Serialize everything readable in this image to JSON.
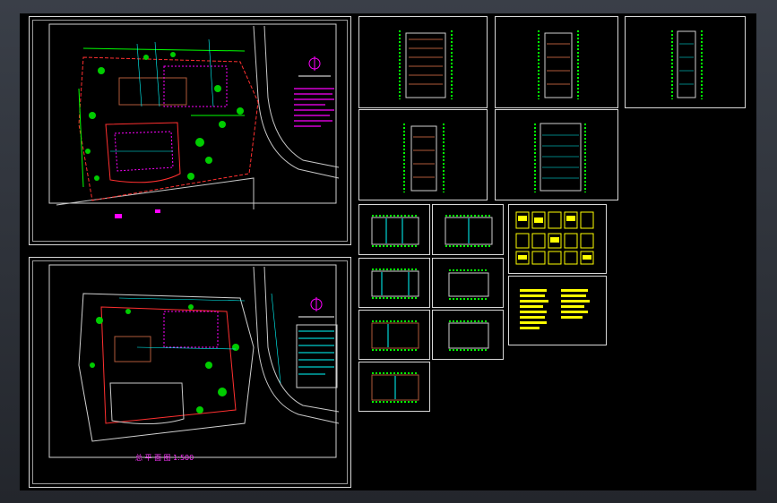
{
  "viewport": {
    "background": "#000000",
    "frame_color": "#2f333a"
  },
  "sheets": {
    "site_plan_1": {
      "name": "site-plan-sheet-1"
    },
    "site_plan_2": {
      "name": "site-plan-sheet-2",
      "scale_label": "总 平 面 图  1:500"
    },
    "elevations": [
      "elevation-1",
      "elevation-2",
      "elevation-3",
      "elevation-4",
      "elevation-5"
    ],
    "floor_plans": [
      "plan-1",
      "plan-2",
      "plan-3",
      "plan-4",
      "plan-5",
      "plan-6",
      "plan-7"
    ],
    "details": [
      "detail-sheet",
      "notes-sheet"
    ]
  },
  "colors": {
    "green": "#00ff00",
    "cyan": "#00ffff",
    "magenta": "#ff00ff",
    "red": "#ff2020",
    "yellow": "#ffff00",
    "white": "#ffffff",
    "brown": "#b05a3a"
  }
}
